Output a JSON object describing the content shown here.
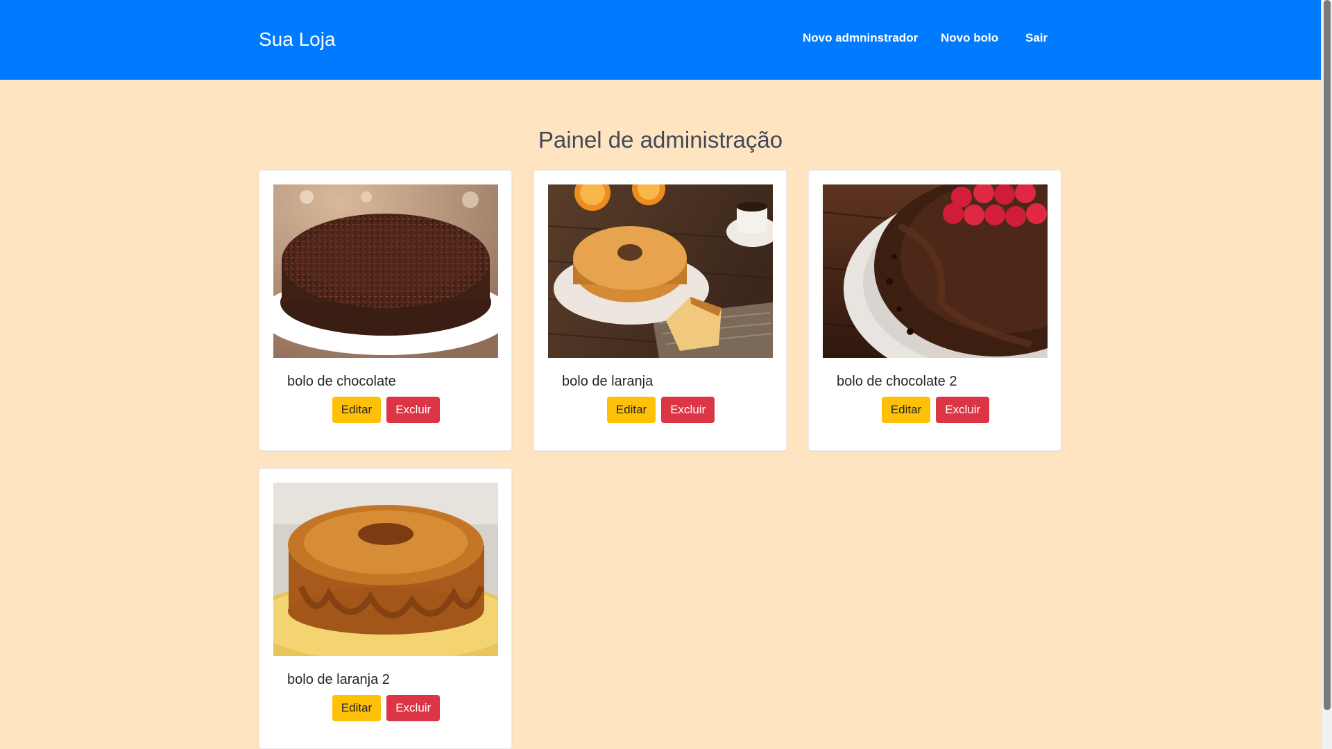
{
  "navbar": {
    "brand": "Sua Loja",
    "links": [
      {
        "label": "Novo admninstrador"
      },
      {
        "label": "Novo bolo"
      },
      {
        "label": "Sair"
      }
    ],
    "color": "#007bff"
  },
  "page": {
    "title": "Painel de administração",
    "background": "#ffe4c2"
  },
  "products": [
    {
      "name": "bolo de chocolate",
      "edit_label": "Editar",
      "delete_label": "Excluir"
    },
    {
      "name": "bolo de laranja",
      "edit_label": "Editar",
      "delete_label": "Excluir"
    },
    {
      "name": "bolo de chocolate 2",
      "edit_label": "Editar",
      "delete_label": "Excluir"
    },
    {
      "name": "bolo de laranja 2",
      "edit_label": "Editar",
      "delete_label": "Excluir"
    }
  ],
  "colors": {
    "edit": "#ffc107",
    "delete": "#dc3545"
  }
}
